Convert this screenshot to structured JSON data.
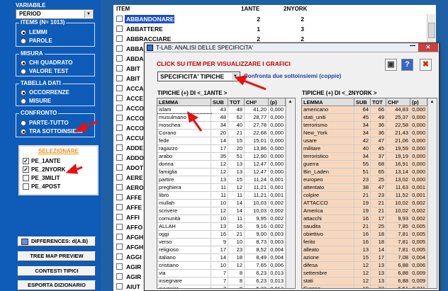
{
  "left": {
    "variabile_title": "VARIABILE",
    "variabile_value": "PERIOD",
    "items_title": "ITEMS (N= 1013)",
    "items_options": [
      "LEMMI",
      "PAROLE"
    ],
    "misura_title": "MISURA",
    "misura_options": [
      "CHI QUADRATO",
      "VALORE TEST"
    ],
    "tabella_title": "TABELLA DATI",
    "tabella_options": [
      "OCCORRENZE",
      "MISURE"
    ],
    "confronto_title": "CONFRONTO",
    "confronto_options": [
      "PARTE-TUTTO",
      "TRA SOTTOINSIEMI"
    ],
    "selezionare_title": "SELEZIONARE",
    "selezionare_items": [
      "PE_1ANTE",
      "PE_2NYORK",
      "PE_3MILIT",
      "PE_4POST"
    ],
    "buttons": [
      "DIFFERENCES: d(A.B)",
      "TREE MAP PREVIEW",
      "CONTESTI TIPICI",
      "ESPORTA DIZIONARIO"
    ]
  },
  "list": {
    "headers": [
      "ITEM",
      "1ANTE",
      "2NYORK"
    ],
    "rows": [
      [
        "ABBANDONARE",
        "2",
        "2"
      ],
      [
        "ABBATTERE",
        "1",
        "3"
      ],
      [
        "ABBRACCIARE",
        "2",
        "2"
      ],
      [
        "ABBA",
        "",
        " "
      ],
      [
        "ABDA",
        "",
        ""
      ],
      [
        "ABIT",
        "",
        ""
      ],
      [
        "ABIT",
        "",
        ""
      ],
      [
        "ACCA",
        "",
        ""
      ],
      [
        "ACCE",
        "",
        ""
      ],
      [
        "ACCO",
        "",
        ""
      ],
      [
        "ACCO",
        "",
        ""
      ],
      [
        "ACCO",
        "",
        ""
      ],
      [
        "ACCU",
        "",
        ""
      ],
      [
        "ADDE",
        "",
        ""
      ],
      [
        "ADDO",
        "",
        ""
      ],
      [
        "ADOT",
        "",
        ""
      ],
      [
        "AERE",
        "",
        ""
      ],
      [
        "AERO",
        "",
        ""
      ],
      [
        "AFFE",
        "",
        ""
      ],
      [
        "AFFE",
        "",
        ""
      ],
      [
        "AFFI",
        "",
        ""
      ],
      [
        "AFFO",
        "",
        ""
      ],
      [
        "AFGH",
        "",
        ""
      ],
      [
        "AFGH",
        "",
        ""
      ],
      [
        "AGGI",
        "",
        ""
      ],
      [
        "AGIR",
        "",
        ""
      ],
      [
        "AGIR",
        "",
        ""
      ],
      [
        "AIUT",
        "",
        ""
      ]
    ]
  },
  "window": {
    "title": "T-LAB: ANALISI DELLE SPECIFICITA'",
    "instruction": "CLICK SU ITEM PER VISUALIZZARE I GRAFICI",
    "combo_value": "SPECIFICITA'  TIPICHE",
    "compare_label": "Confronta due sottoinsiemi  (coppie)",
    "left_heading": "TIPICHE (+) DI <_1ANTE >",
    "right_heading": "TIPICHE (+) DI <_2NYORK >",
    "col_headers": [
      "LEMMA",
      "SUB",
      "TOT",
      "CHI²",
      "(p)"
    ],
    "left_rows": [
      [
        "islam",
        "43",
        "48",
        "41,20",
        "0,000"
      ],
      [
        "musulmano",
        "48",
        "62",
        "28,77",
        "0,000"
      ],
      [
        "moschea",
        "34",
        "40",
        "27,78",
        "0,000"
      ],
      [
        "Corano",
        "20",
        "21",
        "22,68",
        "0,000"
      ],
      [
        "fede",
        "14",
        "15",
        "15,01",
        "0,000"
      ],
      [
        "ragazzo",
        "17",
        "20",
        "13,86",
        "0,000"
      ],
      [
        "arabo",
        "35",
        "51",
        "12,90",
        "0,000"
      ],
      [
        "donna",
        "12",
        "13",
        "12,47",
        "0,000"
      ],
      [
        "famiglia",
        "12",
        "13",
        "12,47",
        "0,000"
      ],
      [
        "partire",
        "13",
        "15",
        "11,24",
        "0,001"
      ],
      [
        "preghiera",
        "11",
        "12",
        "11,21",
        "0,001"
      ],
      [
        "libro",
        "11",
        "11",
        "11,21",
        "0,001"
      ],
      [
        "mullah",
        "10",
        "14",
        "10,03",
        "0,002"
      ],
      [
        "scrivere",
        "12",
        "14",
        "10,03",
        "0,002"
      ],
      [
        "comunità",
        "10",
        "11",
        "9,95",
        "0,002"
      ],
      [
        "ALLAH",
        "13",
        "16",
        "9,16",
        "0,002"
      ],
      [
        "oggi",
        "16",
        "21",
        "9,00",
        "0,003"
      ],
      [
        "verso",
        "9",
        "10",
        "8,73",
        "0,003"
      ],
      [
        "religioso",
        "17",
        "23",
        "8,52",
        "0,004"
      ],
      [
        "italiano",
        "14",
        "18",
        "8,49",
        "0,004"
      ],
      [
        "cristiano",
        "10",
        "12",
        "7,65",
        "0,006"
      ],
      [
        "via",
        "7",
        "8",
        "6,23",
        "0,013"
      ],
      [
        "insegnare",
        "7",
        "8",
        "6,23",
        "0,013"
      ],
      [
        "avvenire",
        "7",
        "8",
        "6,23",
        "0,013"
      ]
    ],
    "right_rows": [
      [
        "americano",
        "64",
        "66",
        "44,83",
        "0,000"
      ],
      [
        "stati_uniti",
        "45",
        "49",
        "25,37",
        "0,000"
      ],
      [
        "terrorismo",
        "34",
        "36",
        "22,58",
        "0,000"
      ],
      [
        "New_York",
        "34",
        "36",
        "21,43",
        "0,000"
      ],
      [
        "usare",
        "42",
        "47",
        "21,06",
        "0,000"
      ],
      [
        "militare",
        "40",
        "45",
        "19,59",
        "0,000"
      ],
      [
        "terroristico",
        "34",
        "37",
        "19,19",
        "0,000"
      ],
      [
        "guerra",
        "55",
        "68",
        "16,91",
        "0,000"
      ],
      [
        "Bin_Laden",
        "51",
        "65",
        "13,14",
        "0,000"
      ],
      [
        "europeo",
        "23",
        "25",
        "13,02",
        "0,000"
      ],
      [
        "attentato",
        "38",
        "47",
        "11,63",
        "0,001"
      ],
      [
        "colpire",
        "21",
        "23",
        "11,52",
        "0,001"
      ],
      [
        "ATTACCO",
        "19",
        "21",
        "10,02",
        "0,002"
      ],
      [
        "America",
        "19",
        "21",
        "10,02",
        "0,002"
      ],
      [
        "attacchi",
        "16",
        "17",
        "9,93",
        "0,002"
      ],
      [
        "saudita",
        "21",
        "25",
        "7,85",
        "0,005"
      ],
      [
        "obiettivo",
        "16",
        "18",
        "7,81",
        "0,005"
      ],
      [
        "ferito",
        "16",
        "18",
        "7,81",
        "0,005"
      ],
      [
        "alleato",
        "13",
        "14",
        "7,81",
        "0,005"
      ],
      [
        "azione",
        "15",
        "17",
        "7,08",
        "0,004"
      ],
      [
        "difesa",
        "12",
        "13",
        "6,88",
        "0,006"
      ],
      [
        "settembre",
        "12",
        "13",
        "6,88",
        "0,009"
      ],
      [
        "stati",
        "12",
        "13",
        "6,88",
        "0,009"
      ],
      [
        "Europa",
        "19",
        "23",
        "6,51",
        "0,011"
      ]
    ]
  }
}
